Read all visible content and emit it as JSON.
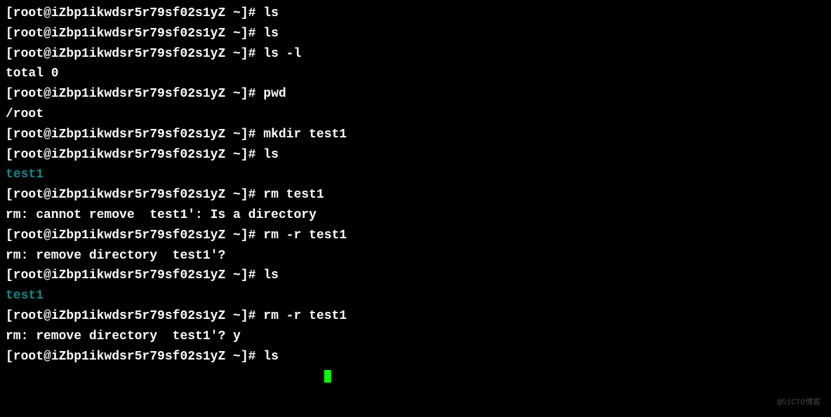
{
  "terminal": {
    "prompt": "[root@iZbp1ikwdsr5r79sf02s1yZ ~]#",
    "lines": [
      {
        "type": "cmd",
        "command": "ls"
      },
      {
        "type": "cmd",
        "command": "ls"
      },
      {
        "type": "cmd",
        "command": "ls -l"
      },
      {
        "type": "out",
        "text": "total 0"
      },
      {
        "type": "cmd",
        "command": "pwd"
      },
      {
        "type": "out",
        "text": "/root"
      },
      {
        "type": "cmd",
        "command": "mkdir test1"
      },
      {
        "type": "cmd",
        "command": "ls"
      },
      {
        "type": "dir",
        "text": "test1"
      },
      {
        "type": "cmd",
        "command": "rm test1"
      },
      {
        "type": "out",
        "text": "rm: cannot remove  test1': Is a directory"
      },
      {
        "type": "cmd",
        "command": "rm -r test1"
      },
      {
        "type": "out",
        "text": "rm: remove directory  test1'?"
      },
      {
        "type": "cmd",
        "command": "ls"
      },
      {
        "type": "dir",
        "text": "test1"
      },
      {
        "type": "cmd",
        "command": "rm -r test1"
      },
      {
        "type": "out",
        "text": "rm: remove directory  test1'? y"
      },
      {
        "type": "cmd",
        "command": "ls"
      }
    ]
  },
  "watermark": "@51CTO博客"
}
